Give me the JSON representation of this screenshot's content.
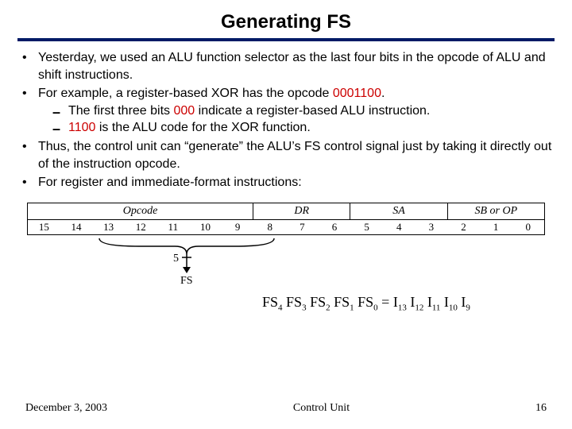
{
  "title": "Generating FS",
  "bullets": {
    "b1": "Yesterday, we used an ALU function selector as the last four bits in the opcode of ALU and shift instructions.",
    "b2_pre": "For example, a register-based XOR has the opcode ",
    "b2_code": "0001100",
    "b2_post": ".",
    "b2a_pre": "The first three bits ",
    "b2a_code": "000",
    "b2a_post": " indicate a register-based ALU instruction.",
    "b2b_code": "1100",
    "b2b_post": " is the ALU code for the XOR function.",
    "b3": "Thus, the control unit can “generate” the ALU’s FS control signal just by taking it directly out of the instruction opcode.",
    "b4": "For register and immediate-format instructions:"
  },
  "fields": {
    "opcode": "Opcode",
    "dr": "DR",
    "sa": "SA",
    "sb": "SB or OP"
  },
  "bits": [
    "15",
    "14",
    "13",
    "12",
    "11",
    "10",
    "9",
    "8",
    "7",
    "6",
    "5",
    "4",
    "3",
    "2",
    "1",
    "0"
  ],
  "brace": {
    "count": "5",
    "label": "FS"
  },
  "eq": {
    "lhs": [
      "FS",
      "4",
      " FS",
      "3",
      " FS",
      "2",
      " FS",
      "1",
      " FS",
      "0"
    ],
    "mid": "  =  ",
    "rhs": [
      "I",
      "13",
      " I",
      "12",
      " I",
      "11",
      " I",
      "10",
      " I",
      "9"
    ]
  },
  "footer": {
    "date": "December 3, 2003",
    "center": "Control Unit",
    "page": "16"
  }
}
